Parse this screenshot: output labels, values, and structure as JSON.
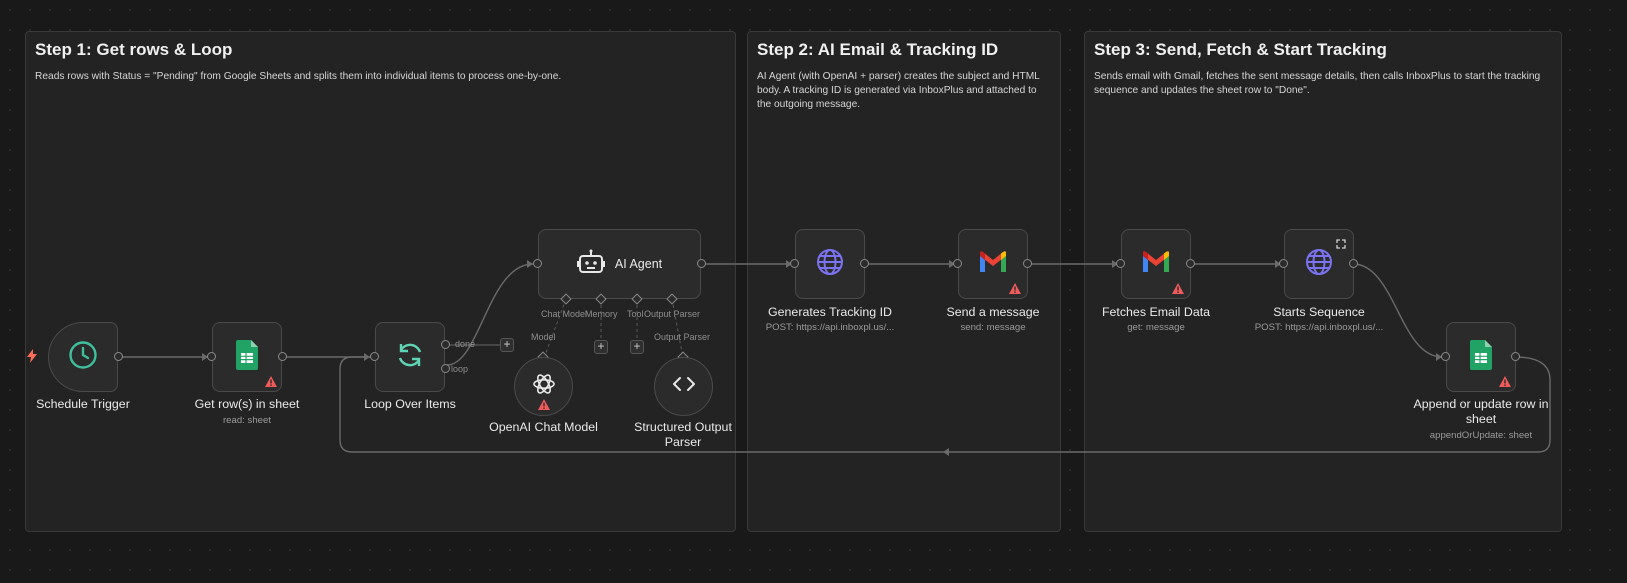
{
  "sticky_notes": [
    {
      "title": "Step 1: Get rows & Loop",
      "body": "Reads rows with Status = \"Pending\" from Google Sheets and splits them into individual items to process one-by-one."
    },
    {
      "title": "Step 2: AI Email & Tracking ID",
      "body": "AI Agent (with OpenAI + parser) creates the subject and HTML body. A tracking ID is generated via InboxPlus and attached to the outgoing message."
    },
    {
      "title": "Step 3: Send, Fetch & Start Tracking",
      "body": "Sends email with Gmail, fetches the sent message details, then calls InboxPlus to start the tracking sequence and updates the sheet row to \"Done\"."
    }
  ],
  "nodes": {
    "schedule_trigger": {
      "label": "Schedule Trigger",
      "icon": "clock-icon"
    },
    "get_rows": {
      "label": "Get row(s) in sheet",
      "sub": "read: sheet",
      "icon": "google-sheets-icon"
    },
    "loop": {
      "label": "Loop Over Items",
      "icon": "refresh-icon",
      "out_done": "done",
      "out_loop": "loop"
    },
    "ai_agent": {
      "label": "AI Agent",
      "icon": "robot-icon",
      "port_chat_model": "Chat Model",
      "port_memory": "Memory",
      "port_tool": "Tool",
      "port_output_parser": "Output Parser"
    },
    "openai": {
      "label": "OpenAI Chat Model",
      "port": "Model",
      "icon": "openai-icon"
    },
    "parser": {
      "label": "Structured Output Parser",
      "port": "Output Parser",
      "icon": "code-icon"
    },
    "tracking_id": {
      "label": "Generates Tracking ID",
      "sub": "POST: https://api.inboxpl.us/...",
      "icon": "globe-icon"
    },
    "send_message": {
      "label": "Send a message",
      "sub": "send: message",
      "icon": "gmail-icon"
    },
    "fetch_email": {
      "label": "Fetches Email Data",
      "sub": "get: message",
      "icon": "gmail-icon"
    },
    "start_sequence": {
      "label": "Starts Sequence",
      "sub": "POST: https://api.inboxpl.us/...",
      "icon": "globe-icon"
    },
    "append_row": {
      "label": "Append or update row in sheet",
      "sub": "appendOrUpdate: sheet",
      "icon": "google-sheets-icon"
    }
  },
  "colors": {
    "canvas": "#191919",
    "sticky": "#232323",
    "node": "#2b2b2b",
    "sheets_green": "#21a366",
    "globe_purple": "#7b73f0",
    "trigger_teal": "#3fbf9b",
    "warning_red": "#ef5b5b",
    "lightning_orange": "#ff6d5a"
  }
}
